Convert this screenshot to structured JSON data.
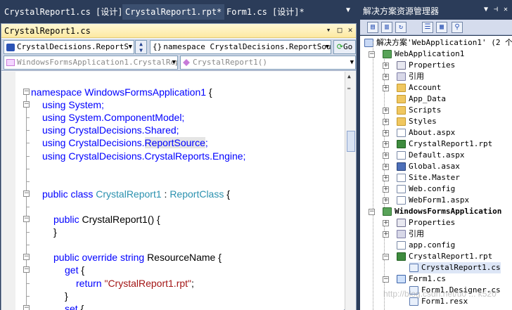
{
  "doc_tabs": [
    {
      "label": "CrystalReport1.cs [设计]"
    },
    {
      "label": "CrystalReport1.rpt*"
    },
    {
      "label": "Form1.cs [设计]*"
    }
  ],
  "editor": {
    "title": "CrystalReport1.cs",
    "title_buttons": {
      "pin": "▾",
      "restore": "□",
      "close": "✕"
    },
    "class_combo": "CrystalDecisions.ReportS",
    "namespace_combo": "namespace CrystalDecisions.ReportSou",
    "go_label": "Go",
    "type_combo": "WindowsFormsApplication1.CrystalRep",
    "member_combo": "CrystalReport1()"
  },
  "code_lines": [
    {
      "indent": 0,
      "segments": [
        {
          "t": "namespace ",
          "c": "kw"
        },
        {
          "t": "WindowsFormsApplication1 ",
          "c": "kw"
        },
        {
          "t": "{",
          "c": "tx"
        }
      ]
    },
    {
      "indent": 1,
      "segments": [
        {
          "t": "using ",
          "c": "kw"
        },
        {
          "t": "System;",
          "c": "kw"
        }
      ]
    },
    {
      "indent": 1,
      "segments": [
        {
          "t": "using ",
          "c": "kw"
        },
        {
          "t": "System.ComponentModel;",
          "c": "kw"
        }
      ]
    },
    {
      "indent": 1,
      "segments": [
        {
          "t": "using ",
          "c": "kw"
        },
        {
          "t": "CrystalDecisions.Shared;",
          "c": "kw"
        }
      ]
    },
    {
      "indent": 1,
      "segments": [
        {
          "t": "using ",
          "c": "kw"
        },
        {
          "t": "CrystalDecisions.",
          "c": "kw"
        },
        {
          "t": "ReportSource",
          "c": "kwhl"
        },
        {
          "t": ";",
          "c": "kw"
        }
      ]
    },
    {
      "indent": 1,
      "segments": [
        {
          "t": "using ",
          "c": "kw"
        },
        {
          "t": "CrystalDecisions.CrystalReports.Engine;",
          "c": "kw"
        }
      ]
    },
    {
      "indent": 1,
      "segments": []
    },
    {
      "indent": 1,
      "segments": []
    },
    {
      "indent": 1,
      "segments": [
        {
          "t": "public ",
          "c": "kw"
        },
        {
          "t": "class ",
          "c": "kw"
        },
        {
          "t": "CrystalReport1",
          "c": "ty"
        },
        {
          "t": " : ",
          "c": "tx"
        },
        {
          "t": "ReportClass",
          "c": "ty"
        },
        {
          "t": " {",
          "c": "tx"
        }
      ]
    },
    {
      "indent": 2,
      "segments": []
    },
    {
      "indent": 2,
      "segments": [
        {
          "t": "public ",
          "c": "kw"
        },
        {
          "t": "CrystalReport1() {",
          "c": "tx"
        }
      ]
    },
    {
      "indent": 2,
      "segments": [
        {
          "t": "}",
          "c": "tx"
        }
      ]
    },
    {
      "indent": 2,
      "segments": []
    },
    {
      "indent": 2,
      "segments": [
        {
          "t": "public ",
          "c": "kw"
        },
        {
          "t": "override ",
          "c": "kw"
        },
        {
          "t": "string ",
          "c": "kw"
        },
        {
          "t": "ResourceName {",
          "c": "tx"
        }
      ]
    },
    {
      "indent": 3,
      "segments": [
        {
          "t": "get",
          "c": "kw"
        },
        {
          "t": " {",
          "c": "tx"
        }
      ]
    },
    {
      "indent": 4,
      "segments": [
        {
          "t": "return ",
          "c": "kw"
        },
        {
          "t": "\"CrystalReport1.rpt\"",
          "c": "st"
        },
        {
          "t": ";",
          "c": "tx"
        }
      ]
    },
    {
      "indent": 3,
      "segments": [
        {
          "t": "}",
          "c": "tx"
        }
      ]
    },
    {
      "indent": 3,
      "segments": [
        {
          "t": "set",
          "c": "kw"
        },
        {
          "t": " {",
          "c": "tx"
        }
      ]
    }
  ],
  "solution_explorer": {
    "title": "解决方案资源管理器",
    "solution_label": "解决方案'WebApplication1' (2 个",
    "items": [
      {
        "label": "WebApplication1",
        "level": 1,
        "icon": "proj",
        "expander": "−"
      },
      {
        "label": "Properties",
        "level": 2,
        "icon": "props",
        "expander": "+"
      },
      {
        "label": "引用",
        "level": 2,
        "icon": "ref",
        "expander": "+"
      },
      {
        "label": "Account",
        "level": 2,
        "icon": "folder",
        "expander": "+"
      },
      {
        "label": "App_Data",
        "level": 2,
        "icon": "folder",
        "expander": ""
      },
      {
        "label": "Scripts",
        "level": 2,
        "icon": "folder",
        "expander": "+"
      },
      {
        "label": "Styles",
        "level": 2,
        "icon": "folder",
        "expander": "+"
      },
      {
        "label": "About.aspx",
        "level": 2,
        "icon": "file",
        "expander": "+"
      },
      {
        "label": "CrystalReport1.rpt",
        "level": 2,
        "icon": "rpt",
        "expander": "+"
      },
      {
        "label": "Default.aspx",
        "level": 2,
        "icon": "file",
        "expander": "+"
      },
      {
        "label": "Global.asax",
        "level": 2,
        "icon": "asax",
        "expander": "+"
      },
      {
        "label": "Site.Master",
        "level": 2,
        "icon": "file",
        "expander": "+"
      },
      {
        "label": "Web.config",
        "level": 2,
        "icon": "file",
        "expander": "+"
      },
      {
        "label": "WebForm1.aspx",
        "level": 2,
        "icon": "file",
        "expander": "+"
      },
      {
        "label": "WindowsFormsApplication",
        "level": 1,
        "icon": "proj",
        "expander": "−",
        "bold": true
      },
      {
        "label": "Properties",
        "level": 2,
        "icon": "props",
        "expander": "+"
      },
      {
        "label": "引用",
        "level": 2,
        "icon": "ref",
        "expander": "+"
      },
      {
        "label": "app.config",
        "level": 2,
        "icon": "file",
        "expander": ""
      },
      {
        "label": "CrystalReport1.rpt",
        "level": 2,
        "icon": "rpt",
        "expander": "−"
      },
      {
        "label": "CrystalReport1.cs",
        "level": 3,
        "icon": "cs",
        "expander": "",
        "selected": true
      },
      {
        "label": "Form1.cs",
        "level": 2,
        "icon": "form",
        "expander": "−"
      },
      {
        "label": "Form1.Designer.cs",
        "level": 3,
        "icon": "cs",
        "expander": ""
      },
      {
        "label": "Form1.resx",
        "level": 3,
        "icon": "cs",
        "expander": ""
      }
    ]
  },
  "watermark": "http://blog.csdn.net/u0 ... k520"
}
